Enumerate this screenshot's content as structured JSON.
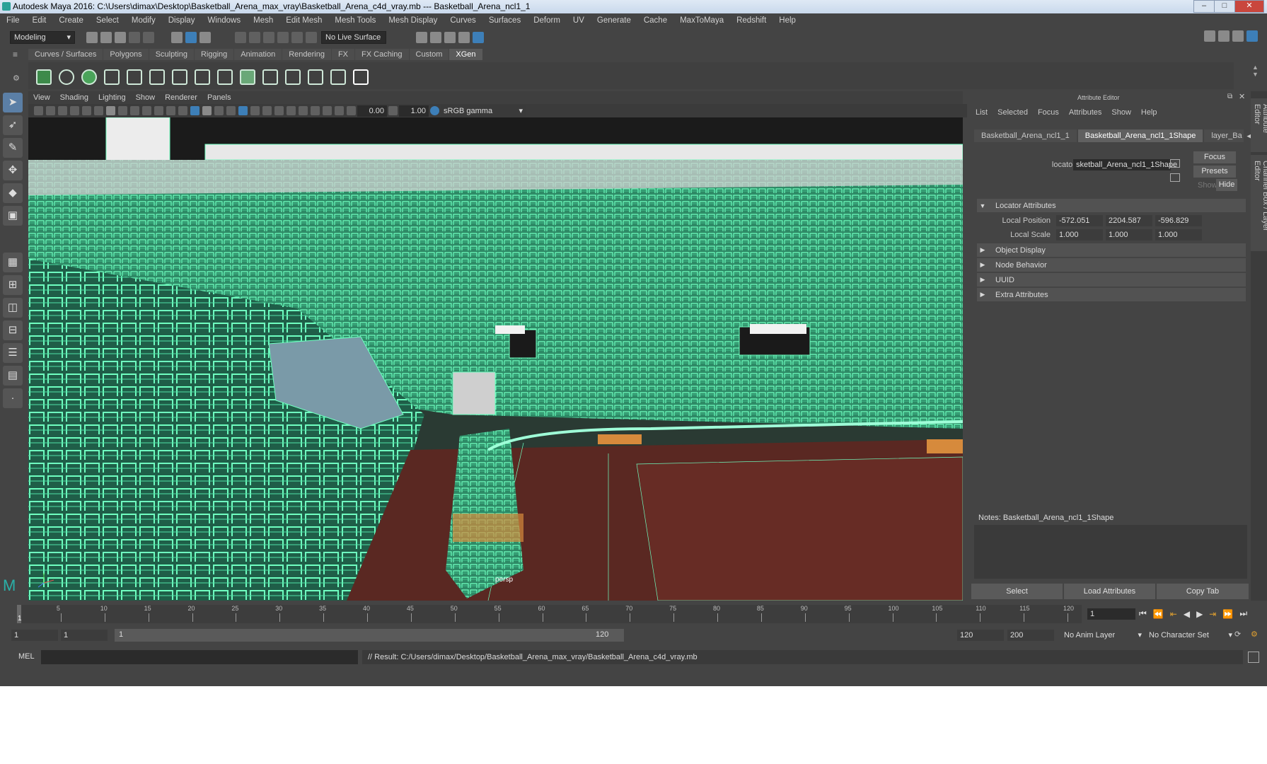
{
  "window": {
    "title": "Autodesk Maya 2016: C:\\Users\\dimax\\Desktop\\Basketball_Arena_max_vray\\Basketball_Arena_c4d_vray.mb   ---   Basketball_Arena_ncl1_1",
    "minimize": "–",
    "maximize": "□",
    "close": "✕"
  },
  "menubar": [
    "File",
    "Edit",
    "Create",
    "Select",
    "Modify",
    "Display",
    "Windows",
    "Mesh",
    "Edit Mesh",
    "Mesh Tools",
    "Mesh Display",
    "Curves",
    "Surfaces",
    "Deform",
    "UV",
    "Generate",
    "Cache",
    "MaxToMaya",
    "Redshift",
    "Help"
  ],
  "status": {
    "mode": "Modeling",
    "live_surface": "No Live Surface"
  },
  "shelf_tabs": [
    "Curves / Surfaces",
    "Polygons",
    "Sculpting",
    "Rigging",
    "Animation",
    "Rendering",
    "FX",
    "FX Caching",
    "Custom",
    "XGen"
  ],
  "shelf_active": "XGen",
  "viewport": {
    "menu": [
      "View",
      "Shading",
      "Lighting",
      "Show",
      "Renderer",
      "Panels"
    ],
    "exposure": "0.00",
    "gamma": "1.00",
    "color_space": "sRGB gamma",
    "camera_label": "persp"
  },
  "attribute_editor": {
    "title": "Attribute Editor",
    "menu": [
      "List",
      "Selected",
      "Focus",
      "Attributes",
      "Show",
      "Help"
    ],
    "tabs": [
      "Basketball_Arena_ncl1_1",
      "Basketball_Arena_ncl1_1Shape",
      "layer_Ba"
    ],
    "active_tab": "Basketball_Arena_ncl1_1Shape",
    "node_label": "locator:",
    "node_value": "sketball_Arena_ncl1_1Shape",
    "focus_btn": "Focus",
    "presets_btn": "Presets",
    "show_btn": "Show",
    "hide_btn": "Hide",
    "sections": {
      "locator": "Locator Attributes",
      "object_display": "Object Display",
      "node_behavior": "Node Behavior",
      "uuid": "UUID",
      "extra": "Extra Attributes"
    },
    "local_position_label": "Local Position",
    "local_position": [
      "-572.051",
      "2204.587",
      "-596.829"
    ],
    "local_scale_label": "Local Scale",
    "local_scale": [
      "1.000",
      "1.000",
      "1.000"
    ],
    "notes_label": "Notes:  Basketball_Arena_ncl1_1Shape",
    "buttons": [
      "Select",
      "Load Attributes",
      "Copy Tab"
    ],
    "side_tabs": [
      "Attribute Editor",
      "Channel Box / Layer Editor"
    ]
  },
  "timeline": {
    "ticks": [
      "5",
      "10",
      "15",
      "20",
      "25",
      "30",
      "35",
      "40",
      "45",
      "50",
      "55",
      "60",
      "65",
      "70",
      "75",
      "80",
      "85",
      "90",
      "95",
      "100",
      "105",
      "110",
      "115",
      "120"
    ],
    "current_frame": "1",
    "frame_field": "1"
  },
  "range": {
    "start": "1",
    "playback_start": "1",
    "slider_start": "1",
    "slider_end": "120",
    "playback_end": "120",
    "end": "200",
    "anim_layer": "No Anim Layer",
    "character_set": "No Character Set"
  },
  "command_line": {
    "lang": "MEL",
    "result": "// Result: C:/Users/dimax/Desktop/Basketball_Arena_max_vray/Basketball_Arena_c4d_vray.mb"
  }
}
